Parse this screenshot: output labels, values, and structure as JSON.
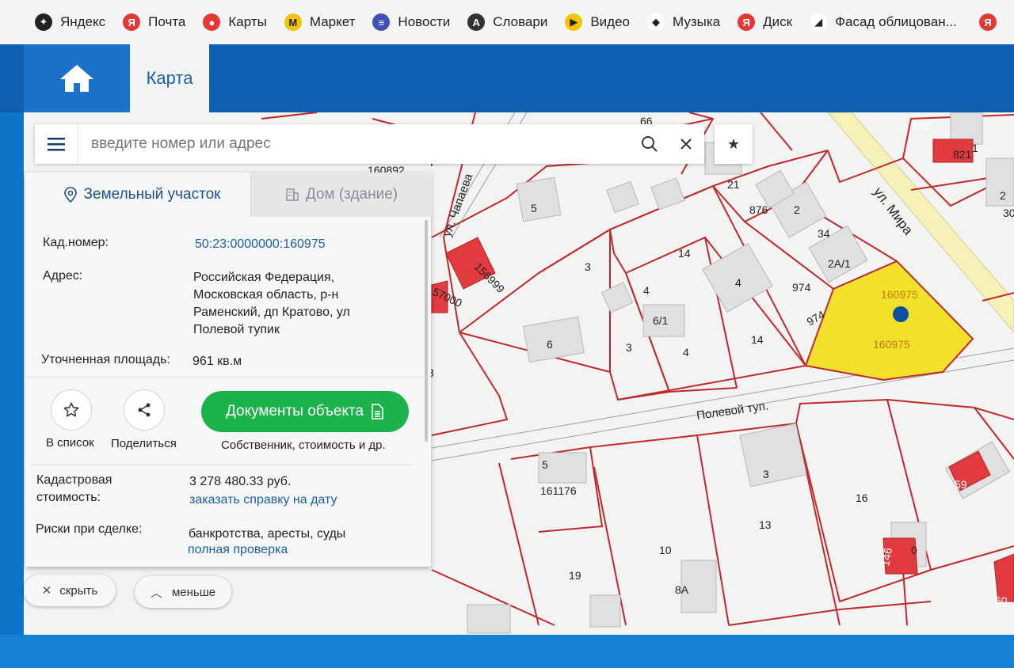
{
  "bookmarks": [
    {
      "label": "Яндекс",
      "icon": "yandex-icon",
      "color": "#222222",
      "glyph": "✦"
    },
    {
      "label": "Почта",
      "icon": "yandex-mail-icon",
      "color": "#e53935",
      "glyph": "Я"
    },
    {
      "label": "Карты",
      "icon": "map-pin-icon",
      "color": "#e53935",
      "glyph": "●"
    },
    {
      "label": "Маркет",
      "icon": "market-icon",
      "color": "#f4c400",
      "glyph": "М"
    },
    {
      "label": "Новости",
      "icon": "news-icon",
      "color": "#3f51b5",
      "glyph": "≡"
    },
    {
      "label": "Словари",
      "icon": "dictionary-icon",
      "color": "#333333",
      "glyph": "A"
    },
    {
      "label": "Видео",
      "icon": "video-icon",
      "color": "#f4c400",
      "glyph": "▶"
    },
    {
      "label": "Музыка",
      "icon": "music-icon",
      "color": "#ffffff",
      "glyph": "◆"
    },
    {
      "label": "Диск",
      "icon": "disk-icon",
      "color": "#e53935",
      "glyph": "Я"
    },
    {
      "label": "Фасад облицован...",
      "icon": "page-icon",
      "color": "#ffffff",
      "glyph": "◢"
    }
  ],
  "bookmark_end_glyph": "Я",
  "header": {
    "map_tab": "Карта"
  },
  "search": {
    "placeholder": "введите номер или адрес"
  },
  "panel": {
    "tab_land": "Земельный участок",
    "tab_house": "Дом (здание)",
    "cad_label": "Кад.номер:",
    "cad_value": "50:23:0000000:160975",
    "addr_label": "Адрес:",
    "addr_lines": [
      "Российская Федерация,",
      "Московская область, р-н",
      "Раменский, дп Кратово, ул",
      "Полевой тупик"
    ],
    "area_label": "Уточненная площадь:",
    "area_value": "961 кв.м",
    "to_list": "В список",
    "share": "Поделиться",
    "docs_btn": "Документы объекта",
    "docs_sub": "Собственник, стоимость и др.",
    "cost_label_1": "Кадастровая",
    "cost_label_2": "стоимость:",
    "cost_value": "3 278 480.33 руб.",
    "cost_link": "заказать справку на дату",
    "risk_label": "Риски при сделке:",
    "risk_value": "банкротства, аресты, суды",
    "risk_link": "полная проверка"
  },
  "buttons": {
    "hide": "скрыть",
    "less": "меньше"
  },
  "map_labels": {
    "street_mira": "ул. Мира",
    "street_chapaeva": "ул. Чапаева",
    "street_polevoy": "Полевой туп.",
    "selected_top": "160975",
    "selected_bottom": "160975",
    "parcels": [
      "66",
      "342",
      "821",
      "1",
      "2",
      "30",
      "160892",
      "5",
      "21",
      "876",
      "2",
      "34",
      "2А/1",
      "156999",
      "57000",
      "3",
      "14",
      "4",
      "974",
      "974",
      "4",
      "6/1",
      "6",
      "3",
      "4",
      "14",
      "3",
      "5",
      "161176",
      "3",
      "16",
      "59",
      "13",
      "10",
      "19",
      "8А",
      "146",
      "60",
      "0"
    ]
  },
  "colors": {
    "selected_parcel": "#f2e12b",
    "parcel_line": "#c0282d",
    "green_button": "#1db34c",
    "header_blue": "#0f5fb0",
    "link_blue": "#1b5ea8"
  }
}
